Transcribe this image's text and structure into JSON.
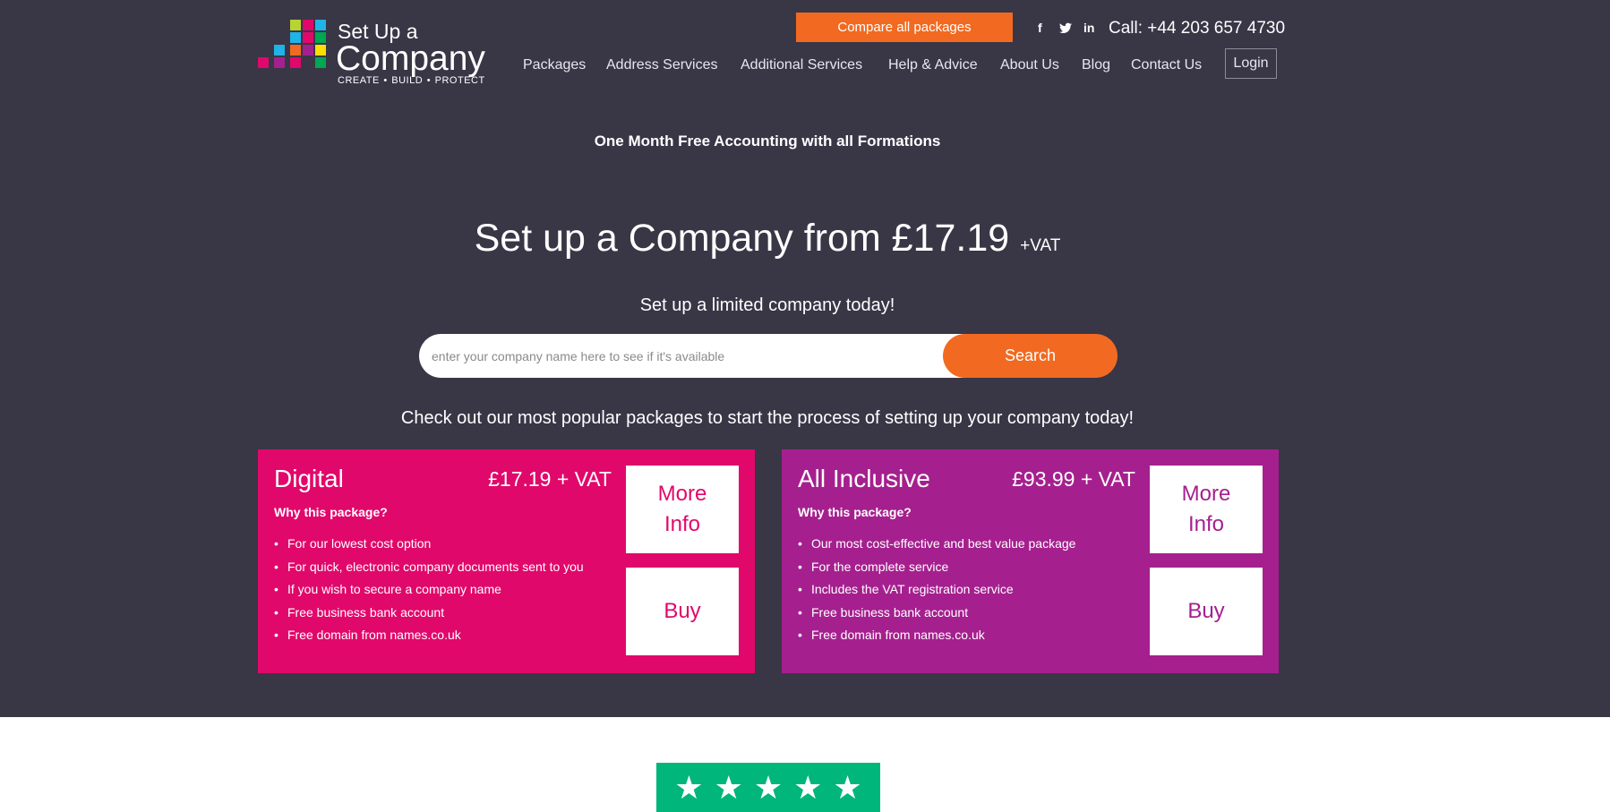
{
  "brand": {
    "line1": "Set Up a",
    "line2": "Company",
    "tagline": "CREATE • BUILD • PROTECT"
  },
  "header": {
    "compare_label": "Compare all packages",
    "social": {
      "facebook": "f",
      "twitter": "t",
      "linkedin": "in"
    },
    "call_prefix": "Call:",
    "phone": "+44 203 657 4730",
    "login_label": "Login"
  },
  "nav": [
    "Packages",
    "Address Services",
    "Additional Services",
    "Help & Advice",
    "About Us",
    "Blog",
    "Contact Us"
  ],
  "promo": "One Month Free Accounting with all Formations",
  "hero": {
    "headline": "Set up a Company from £17.19",
    "headline_vat": "+VAT",
    "subline": "Set up a limited company today!"
  },
  "search": {
    "placeholder": "enter your company name here to see if it's available",
    "value": "",
    "button_label": "Search"
  },
  "packages_heading": "Check out our most popular packages to start the process of setting up your company today!",
  "packages": [
    {
      "name": "Digital",
      "price": "£17.19 + VAT",
      "why": "Why this package?",
      "features": [
        "For our lowest cost option",
        "For quick, electronic company documents sent to you",
        "If you wish to secure a company name",
        "Free business bank account",
        "Free domain from names.co.uk"
      ],
      "more_label": "More Info",
      "buy_label": "Buy",
      "color": "#e1086b"
    },
    {
      "name": "All Inclusive",
      "price": "£93.99 + VAT",
      "why": "Why this package?",
      "features": [
        "Our most cost-effective and best value package",
        "For the complete service",
        "Includes the VAT registration service",
        "Free business bank account",
        "Free domain from names.co.uk"
      ],
      "more_label": "More Info",
      "buy_label": "Buy",
      "color": "#a5208e"
    }
  ],
  "trustpilot": {
    "stars": 5,
    "color": "#00b67a"
  },
  "colors": {
    "background": "#393646",
    "accent": "#f26a21"
  }
}
